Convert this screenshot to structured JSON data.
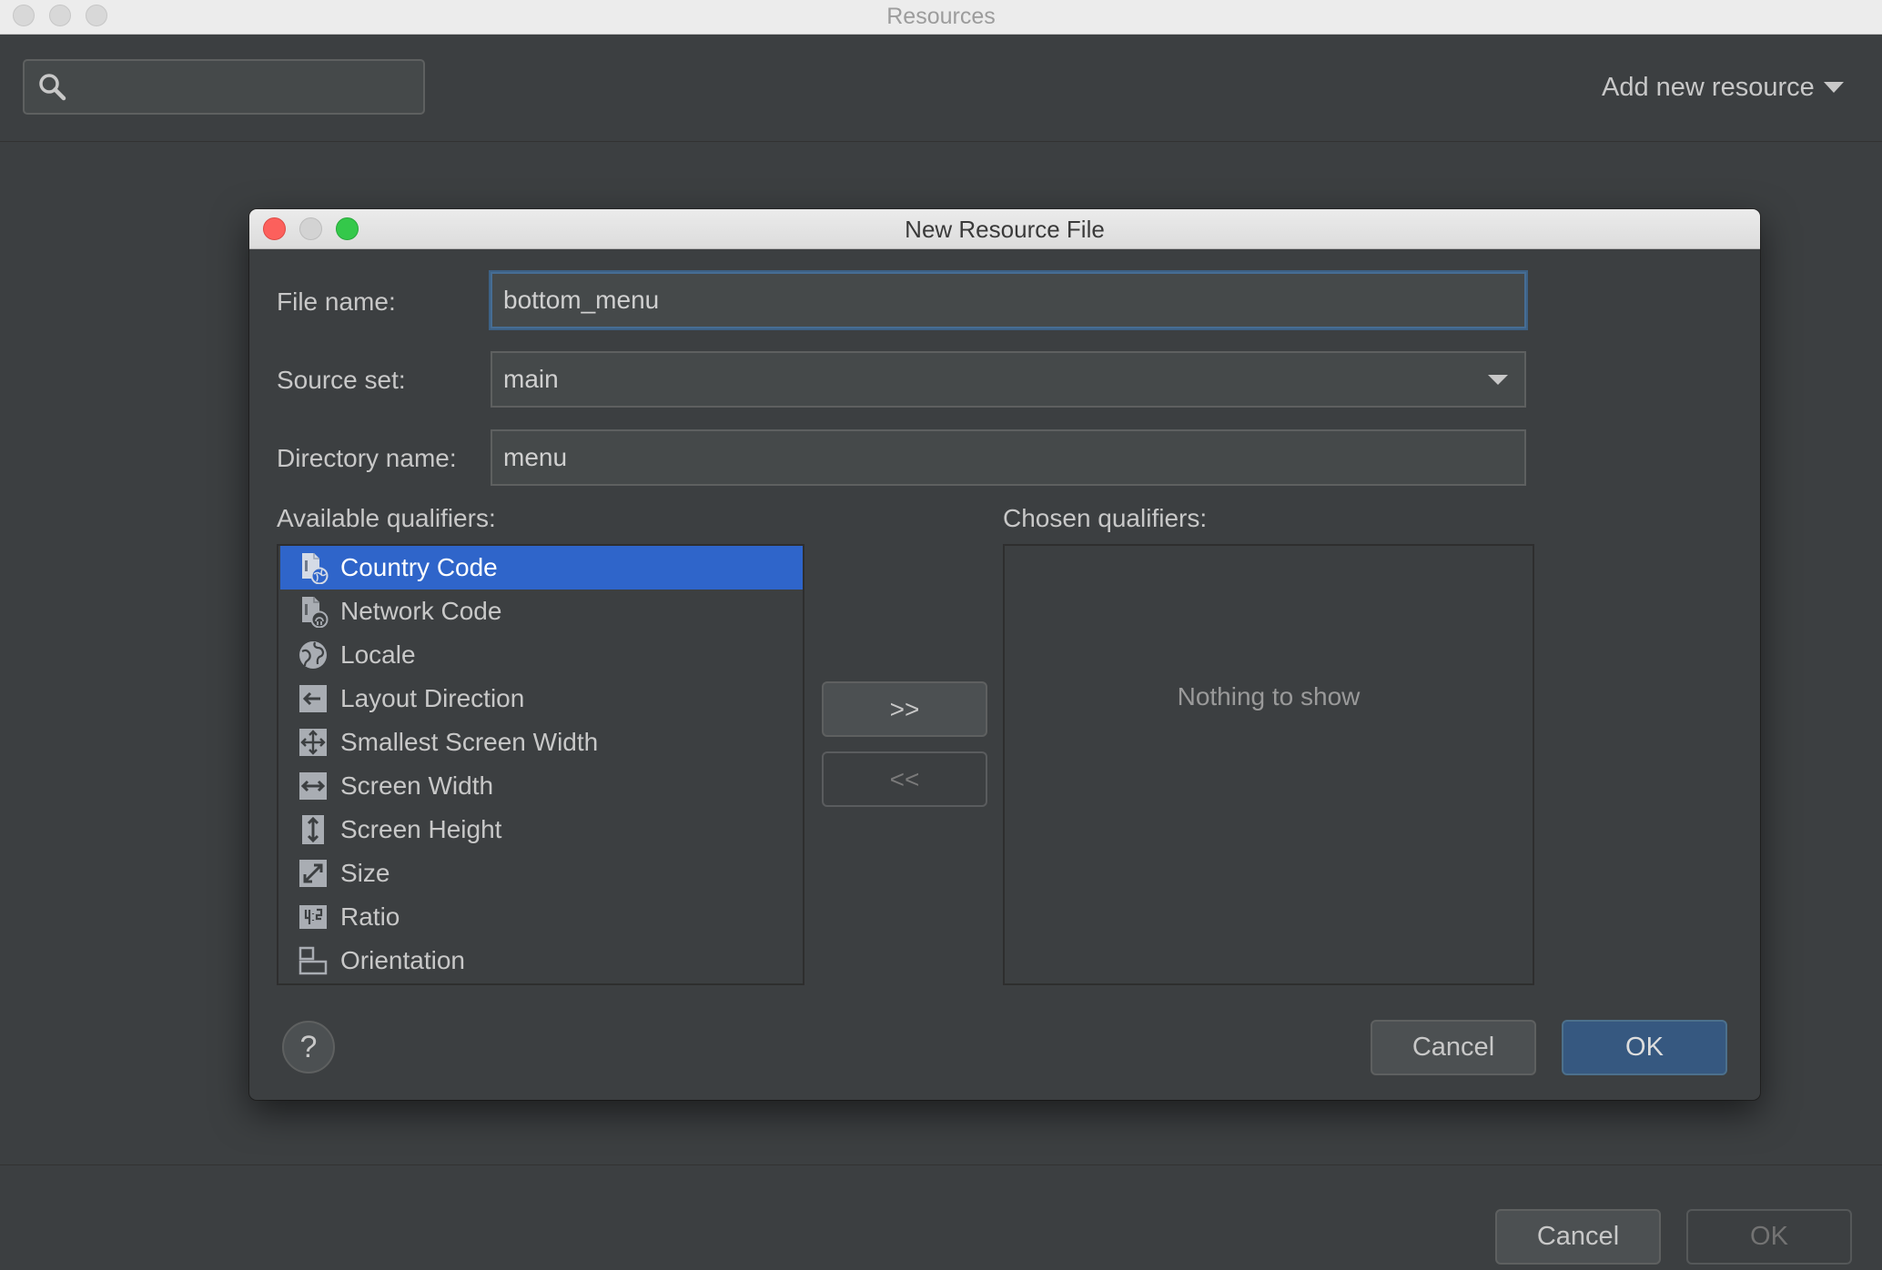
{
  "window": {
    "title": "Resources"
  },
  "toolbar": {
    "search_placeholder": "",
    "add_new_resource_label": "Add new resource"
  },
  "footer": {
    "cancel_label": "Cancel",
    "ok_label": "OK"
  },
  "dialog": {
    "title": "New Resource File",
    "file_name_label": "File name:",
    "file_name_value": "bottom_menu",
    "source_set_label": "Source set:",
    "source_set_value": "main",
    "directory_name_label": "Directory name:",
    "directory_name_value": "menu",
    "available_label": "Available qualifiers:",
    "chosen_label": "Chosen qualifiers:",
    "available_qualifiers": [
      {
        "label": "Country Code",
        "icon": "country-code-icon",
        "selected": true
      },
      {
        "label": "Network Code",
        "icon": "network-code-icon",
        "selected": false
      },
      {
        "label": "Locale",
        "icon": "globe-icon",
        "selected": false
      },
      {
        "label": "Layout Direction",
        "icon": "layout-direction-icon",
        "selected": false
      },
      {
        "label": "Smallest Screen Width",
        "icon": "smallest-width-icon",
        "selected": false
      },
      {
        "label": "Screen Width",
        "icon": "screen-width-icon",
        "selected": false
      },
      {
        "label": "Screen Height",
        "icon": "screen-height-icon",
        "selected": false
      },
      {
        "label": "Size",
        "icon": "size-icon",
        "selected": false
      },
      {
        "label": "Ratio",
        "icon": "ratio-icon",
        "selected": false
      },
      {
        "label": "Orientation",
        "icon": "orientation-icon",
        "selected": false
      }
    ],
    "add_button_label": ">>",
    "remove_button_label": "<<",
    "chosen_empty_text": "Nothing to show",
    "help_label": "?",
    "cancel_label": "Cancel",
    "ok_label": "OK"
  },
  "colors": {
    "background": "#3c3f41",
    "selection": "#2f65ca",
    "focus": "#466d94",
    "primary_button": "#365880"
  }
}
